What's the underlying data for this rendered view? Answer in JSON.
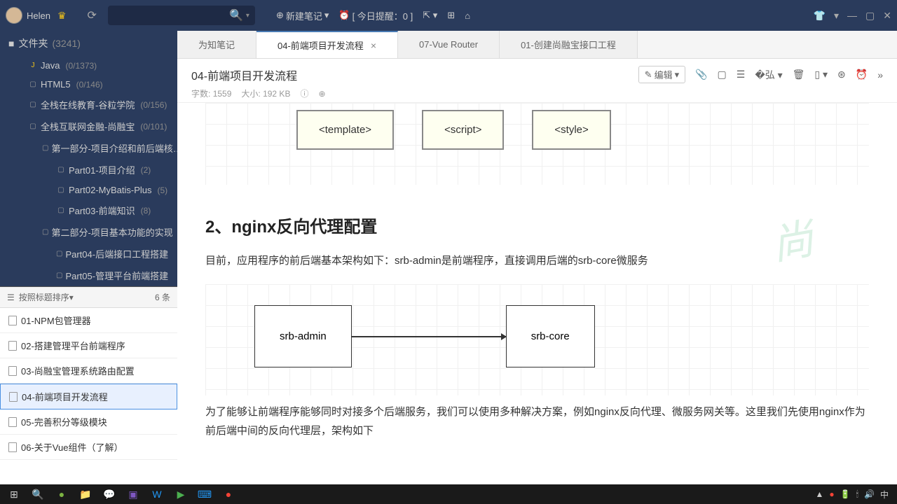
{
  "titlebar": {
    "username": "Helen",
    "new_note": "新建笔记",
    "reminder": "[ 今日提醒：0 ]"
  },
  "sidebar": {
    "folder_label": "文件夹",
    "folder_count": "(3241)",
    "tree": [
      {
        "label": "Java",
        "count": "(0/1373)",
        "depth": 1,
        "icon": "js"
      },
      {
        "label": "HTML5",
        "count": "(0/146)",
        "depth": 1,
        "icon": "folder"
      },
      {
        "label": "全栈在线教育-谷粒学院",
        "count": "(0/156)",
        "depth": 1,
        "icon": "folder"
      },
      {
        "label": "全栈互联网金融-尚融宝",
        "count": "(0/101)",
        "depth": 1,
        "icon": "folder"
      },
      {
        "label": "第一部分-项目介绍和前后端核…",
        "count": "",
        "depth": 2,
        "icon": "folder"
      },
      {
        "label": "Part01-项目介绍",
        "count": "(2)",
        "depth": 3,
        "icon": "folder"
      },
      {
        "label": "Part02-MyBatis-Plus",
        "count": "(5)",
        "depth": 3,
        "icon": "folder"
      },
      {
        "label": "Part03-前端知识",
        "count": "(8)",
        "depth": 3,
        "icon": "folder"
      },
      {
        "label": "第二部分-项目基本功能的实现",
        "count": "",
        "depth": 2,
        "icon": "folder"
      },
      {
        "label": "Part04-后端接口工程搭建",
        "count": "",
        "depth": 3,
        "icon": "folder"
      },
      {
        "label": "Part05-管理平台前端搭建",
        "count": "",
        "depth": 3,
        "icon": "folder"
      }
    ],
    "sort_label": "按照标题排序",
    "item_count": "6 条",
    "notes": [
      {
        "title": "01-NPM包管理器"
      },
      {
        "title": "02-搭建管理平台前端程序"
      },
      {
        "title": "03-尚融宝管理系统路由配置"
      },
      {
        "title": "04-前端项目开发流程"
      },
      {
        "title": "05-完善积分等级模块"
      },
      {
        "title": "06-关于Vue组件（了解）"
      }
    ],
    "active_note_index": 3
  },
  "tabs": [
    {
      "label": "为知笔记",
      "active": false,
      "closable": false
    },
    {
      "label": "04-前端项目开发流程",
      "active": true,
      "closable": true
    },
    {
      "label": "07-Vue Router",
      "active": false,
      "closable": false
    },
    {
      "label": "01-创建尚融宝接口工程",
      "active": false,
      "closable": false
    }
  ],
  "doc": {
    "title": "04-前端项目开发流程",
    "edit_label": "编辑",
    "word_count_label": "字数:",
    "word_count": "1559",
    "size_label": "大小:",
    "size": "192 KB",
    "boxes": [
      "<template>",
      "<script>",
      "<style>"
    ],
    "section2_title": "2、nginx反向代理配置",
    "para1": "目前，应用程序的前后端基本架构如下：srb-admin是前端程序，直接调用后端的srb-core微服务",
    "arch_left": "srb-admin",
    "arch_right": "srb-core",
    "para2": "为了能够让前端程序能够同时对接多个后端服务，我们可以使用多种解决方案，例如nginx反向代理、微服务网关等。这里我们先使用nginx作为前后端中间的反向代理层，架构如下"
  },
  "taskbar": {
    "ime": "中"
  }
}
